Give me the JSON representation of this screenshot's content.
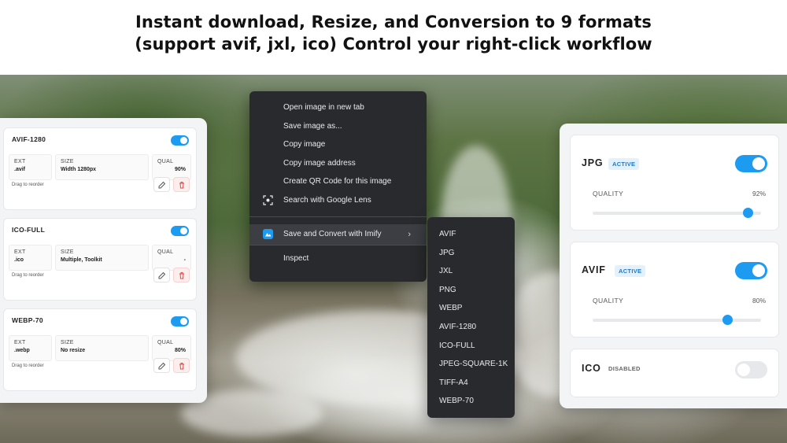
{
  "headline": {
    "line1": "Instant download, Resize, and Conversion to 9 formats",
    "line2": "(support avif, jxl, ico) Control your right-click workflow"
  },
  "colors": {
    "accent": "#1d9bf0",
    "menu_bg": "#292a2d",
    "delete_tint": "#fdeeee"
  },
  "left_panel": {
    "drag_hint": "Drag to reorder",
    "ext_label": "EXT",
    "size_label": "SIZE",
    "qual_label": "QUAL",
    "presets": [
      {
        "name": "AVIF-1280",
        "ext": ".avif",
        "size": "Width 1280px",
        "qual": "90%",
        "enabled": true
      },
      {
        "name": "ICO-FULL",
        "ext": ".ico",
        "size": "Multiple, Toolkit",
        "qual": "-",
        "enabled": true
      },
      {
        "name": "WEBP-70",
        "ext": ".webp",
        "size": "No resize",
        "qual": "80%",
        "enabled": true
      }
    ]
  },
  "context_menu": {
    "items": [
      {
        "label": "Open image in new tab"
      },
      {
        "label": "Save image as..."
      },
      {
        "label": "Copy image"
      },
      {
        "label": "Copy image address"
      },
      {
        "label": "Create QR Code for this image"
      },
      {
        "label": "Search with Google Lens",
        "icon": "lens-icon"
      }
    ],
    "convert_item": {
      "label": "Save and Convert with Imify",
      "icon": "imify-logo-icon"
    },
    "inspect": "Inspect"
  },
  "submenu": {
    "items": [
      "AVIF",
      "JPG",
      "JXL",
      "PNG",
      "WEBP",
      "AVIF-1280",
      "ICO-FULL",
      "JPEG-SQUARE-1K",
      "TIFF-A4",
      "WEBP-70"
    ]
  },
  "right_panel": {
    "quality_label": "QUALITY",
    "formats": [
      {
        "name": "JPG",
        "status": "ACTIVE",
        "enabled": true,
        "quality_text": "92%",
        "quality": 92
      },
      {
        "name": "AVIF",
        "status": "ACTIVE",
        "enabled": true,
        "quality_text": "80%",
        "quality": 80
      },
      {
        "name": "ICO",
        "status": "DISABLED",
        "enabled": false
      }
    ]
  }
}
